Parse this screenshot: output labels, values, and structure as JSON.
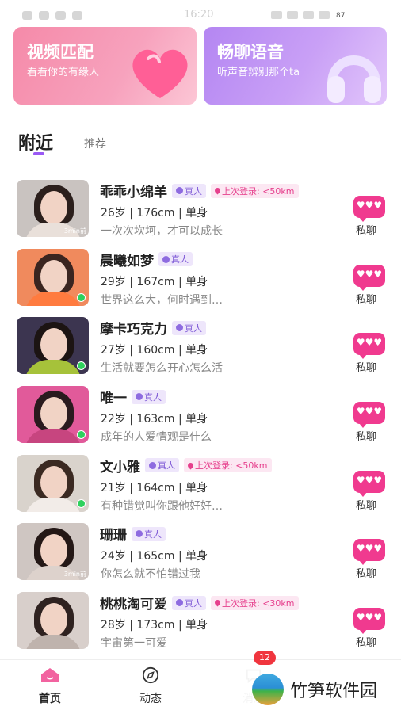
{
  "status_bar": {
    "time": "16:20",
    "battery": "87"
  },
  "banners": [
    {
      "title": "视频匹配",
      "subtitle": "看看你的有缘人"
    },
    {
      "title": "畅聊语音",
      "subtitle": "听声音辨别那个ta"
    }
  ],
  "tabs": {
    "nearby": "附近",
    "recommend": "推荐"
  },
  "users": [
    {
      "name": "乖乖小绵羊",
      "badge_real": "真人",
      "badge_login": "上次登录: <50km",
      "info": "26岁 | 176cm | 单身",
      "bio": "一次次坎坷，才可以成长",
      "time_label": "3min前",
      "online": false,
      "chat": "私聊"
    },
    {
      "name": "晨曦如梦",
      "badge_real": "真人",
      "badge_login": "",
      "info": "29岁 | 167cm | 单身",
      "bio": "世界这么大，何时遇到…",
      "time_label": "",
      "online": true,
      "chat": "私聊"
    },
    {
      "name": "摩卡巧克力",
      "badge_real": "真人",
      "badge_login": "",
      "info": "27岁 | 160cm | 单身",
      "bio": "生活就要怎么开心怎么活",
      "time_label": "",
      "online": true,
      "chat": "私聊"
    },
    {
      "name": "唯一",
      "badge_real": "真人",
      "badge_login": "",
      "info": "22岁 | 163cm | 单身",
      "bio": "成年的人爱情观是什么",
      "time_label": "",
      "online": true,
      "chat": "私聊"
    },
    {
      "name": "文小雅",
      "badge_real": "真人",
      "badge_login": "上次登录: <50km",
      "info": "21岁 | 164cm | 单身",
      "bio": "有种错觉叫你跟他好好…",
      "time_label": "",
      "online": true,
      "chat": "私聊"
    },
    {
      "name": "珊珊",
      "badge_real": "真人",
      "badge_login": "",
      "info": "24岁 | 165cm | 单身",
      "bio": "你怎么就不怕错过我",
      "time_label": "3min前",
      "online": false,
      "chat": "私聊"
    },
    {
      "name": "桃桃淘可爱",
      "badge_real": "真人",
      "badge_login": "上次登录: <30km",
      "info": "28岁 | 173cm | 单身",
      "bio": "宇宙第一可爱",
      "time_label": "",
      "online": false,
      "chat": "私聊"
    }
  ],
  "nav": {
    "home": "首页",
    "moments": "动态",
    "messages": "消息",
    "unread": "12"
  },
  "watermark": "竹笋软件园",
  "colors": {
    "accent": "#9b59f5",
    "chat": "#f03a8f",
    "online": "#2ed15d"
  }
}
